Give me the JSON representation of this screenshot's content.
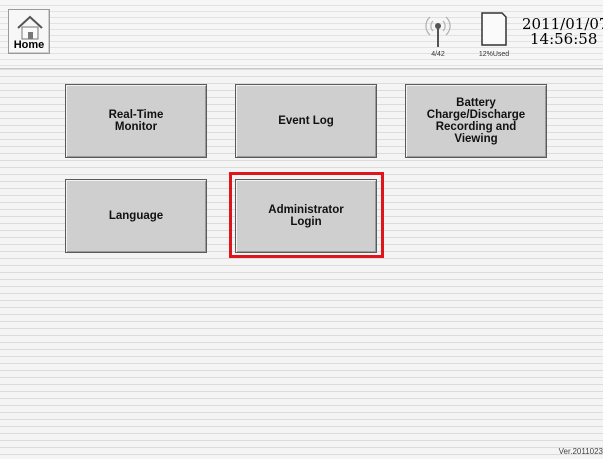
{
  "header": {
    "home_label": "Home",
    "signal_text": "4/42",
    "storage_text": "12%Used",
    "date": "2011/01/07",
    "time": "14:56:58"
  },
  "menu": {
    "real_time_monitor": "Real-Time\nMonitor",
    "event_log": "Event Log",
    "battery": "Battery\nCharge/Discharge\nRecording and\nViewing",
    "language": "Language",
    "admin_login": "Administrator\nLogin"
  },
  "highlight": {
    "target": "Administrator Login",
    "color": "#e0141b"
  },
  "footer": {
    "version": "Ver.2011023"
  }
}
